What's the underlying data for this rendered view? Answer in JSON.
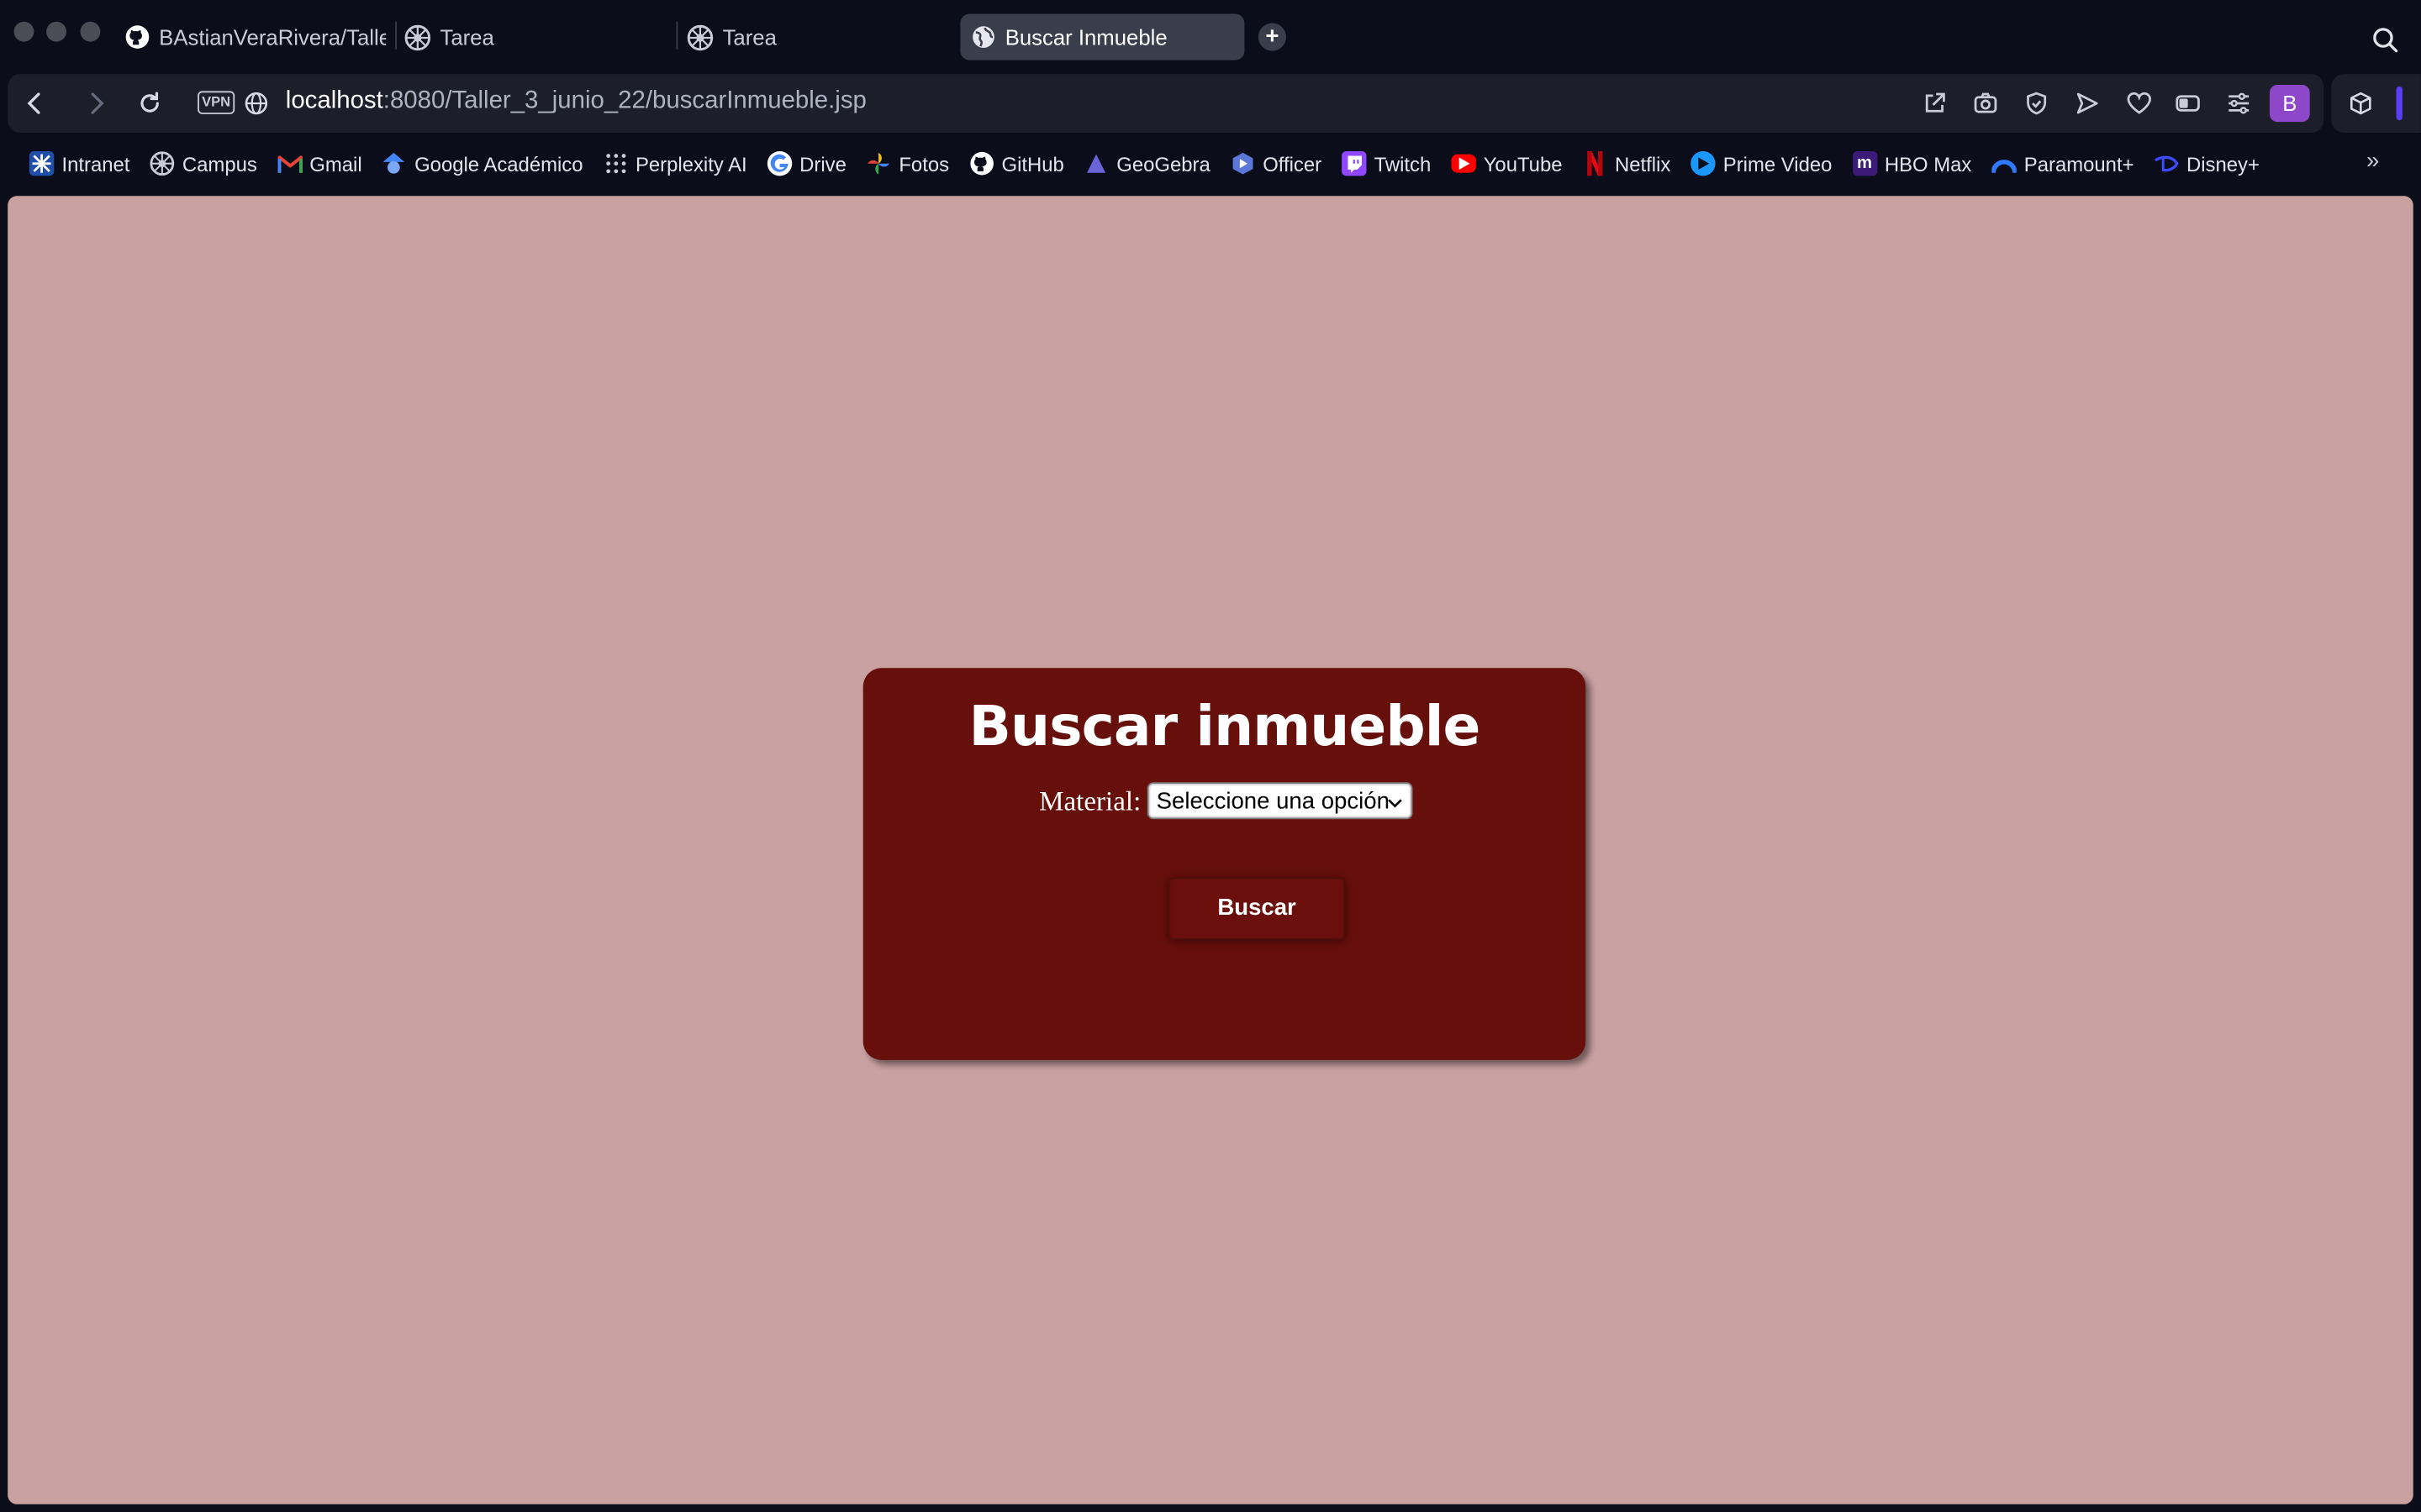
{
  "browser": {
    "tabs": [
      {
        "title": "BAstianVeraRivera/Taller",
        "icon": "github-icon"
      },
      {
        "title": "Tarea",
        "icon": "campus-icon"
      },
      {
        "title": "Tarea",
        "icon": "campus-icon"
      },
      {
        "title": "Buscar Inmueble",
        "icon": "globe-icon",
        "active": true
      }
    ],
    "new_tab_label": "+",
    "url": {
      "host": "localhost",
      "path": ":8080/Taller_3_junio_22/buscarInmueble.jsp"
    },
    "vpn_label": "VPN",
    "profile_initial": "B",
    "bookmarks": [
      {
        "label": "Intranet",
        "icon": "intranet-icon"
      },
      {
        "label": "Campus",
        "icon": "campus-icon"
      },
      {
        "label": "Gmail",
        "icon": "gmail-icon"
      },
      {
        "label": "Google Académico",
        "icon": "scholar-icon"
      },
      {
        "label": "Perplexity AI",
        "icon": "perplexity-icon"
      },
      {
        "label": "Drive",
        "icon": "google-icon"
      },
      {
        "label": "Fotos",
        "icon": "photos-icon"
      },
      {
        "label": "GitHub",
        "icon": "github-icon"
      },
      {
        "label": "GeoGebra",
        "icon": "geogebra-icon"
      },
      {
        "label": "Officer",
        "icon": "officer-icon"
      },
      {
        "label": "Twitch",
        "icon": "twitch-icon"
      },
      {
        "label": "YouTube",
        "icon": "youtube-icon"
      },
      {
        "label": "Netflix",
        "icon": "netflix-icon"
      },
      {
        "label": "Prime Video",
        "icon": "prime-video-icon"
      },
      {
        "label": "HBO Max",
        "icon": "hbo-max-icon"
      },
      {
        "label": "Paramount+",
        "icon": "paramount-icon"
      },
      {
        "label": "Disney+",
        "icon": "disney-icon"
      }
    ],
    "bookmarks_more": "»"
  },
  "page": {
    "title": "Buscar inmueble",
    "material_label": "Material:",
    "material_select": {
      "selected": "Seleccione una opción"
    },
    "search_button": "Buscar"
  },
  "colors": {
    "page_background": "#c9a1a1",
    "card_background": "#660f0b",
    "browser_chrome": "#0b0d1a"
  }
}
